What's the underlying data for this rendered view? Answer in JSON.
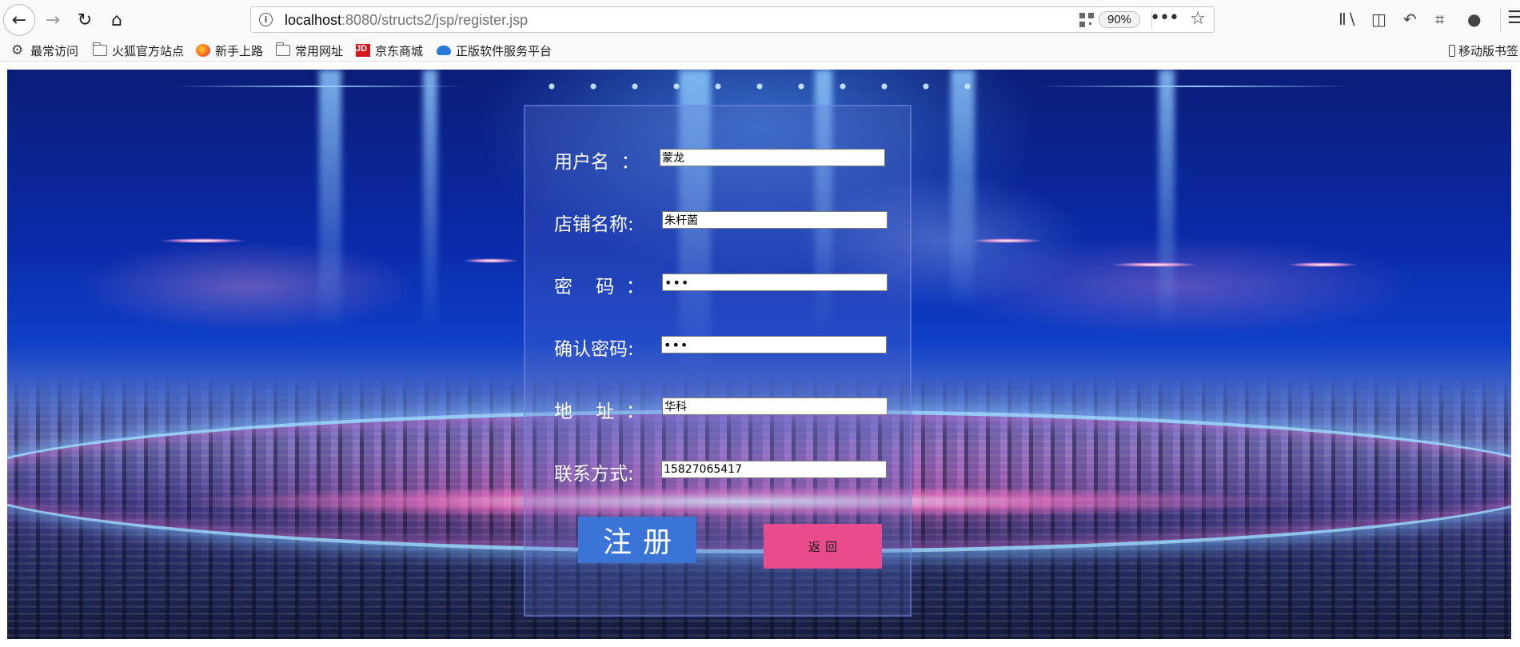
{
  "browser": {
    "url_host": "localhost",
    "url_rest": ":8080/structs2/jsp/register.jsp",
    "zoom": "90%",
    "icons": {
      "back": "back-arrow-icon",
      "forward": "forward-arrow-icon",
      "reload": "reload-icon",
      "home": "home-icon",
      "info": "info-icon",
      "qr": "qr-code-icon",
      "more": "more-icon",
      "bookmark": "star-icon",
      "library": "library-icon",
      "sidebar": "sidebar-icon",
      "undo": "undo-icon",
      "screenshot": "crop-icon",
      "chat": "chat-icon",
      "menu": "hamburger-menu-icon"
    }
  },
  "bookmarks": [
    {
      "label": "最常访问",
      "icon": "gear-icon"
    },
    {
      "label": "火狐官方站点",
      "icon": "folder-icon"
    },
    {
      "label": "新手上路",
      "icon": "firefox-icon"
    },
    {
      "label": "常用网址",
      "icon": "folder-icon"
    },
    {
      "label": "京东商城",
      "icon": "jd-icon"
    },
    {
      "label": "正版软件服务平台",
      "icon": "cloud-icon"
    },
    {
      "label": "移动版书签",
      "icon": "mobile-icon"
    }
  ],
  "form": {
    "fields": [
      {
        "label": "用户名  ：",
        "value": "蒙龙",
        "type": "text"
      },
      {
        "label": "店铺名称:",
        "value": "朱杆菌",
        "type": "text"
      },
      {
        "label": "密    码  ：",
        "value": "•••",
        "type": "password"
      },
      {
        "label": "确认密码:",
        "value": "•••",
        "type": "password"
      },
      {
        "label": "地    址  ：",
        "value": "华科",
        "type": "text"
      },
      {
        "label": "联系方式:",
        "value": "15827065417",
        "type": "text"
      }
    ],
    "register_label": "注册",
    "return_label": "返回"
  },
  "colors": {
    "register_button": "#3a74d6",
    "return_button": "#e94c8c",
    "page_background": "#0f3fc8"
  }
}
